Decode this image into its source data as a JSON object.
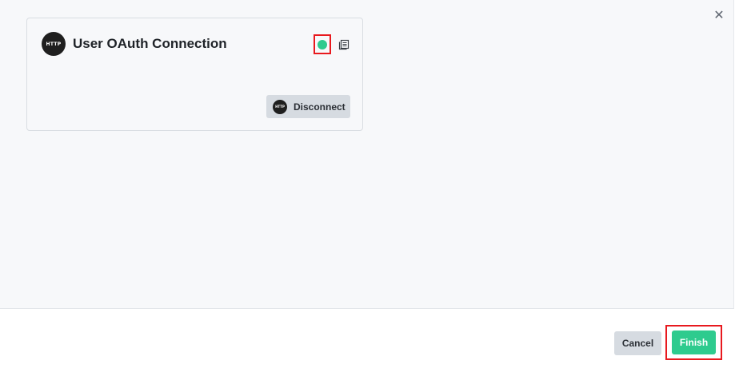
{
  "dialog": {
    "close_glyph": "✕"
  },
  "connection_card": {
    "logo_text": "HTTP",
    "title": "User OAuth Connection",
    "status_color": "#2ecb8e",
    "status_icon": "status-dot-icon",
    "details_icon": "details-icon",
    "disconnect_logo_text": "HTTP",
    "disconnect_label": "Disconnect"
  },
  "footer": {
    "cancel_label": "Cancel",
    "finish_label": "Finish",
    "finish_color": "#2ecb8e",
    "highlight_color": "#e8191e"
  }
}
